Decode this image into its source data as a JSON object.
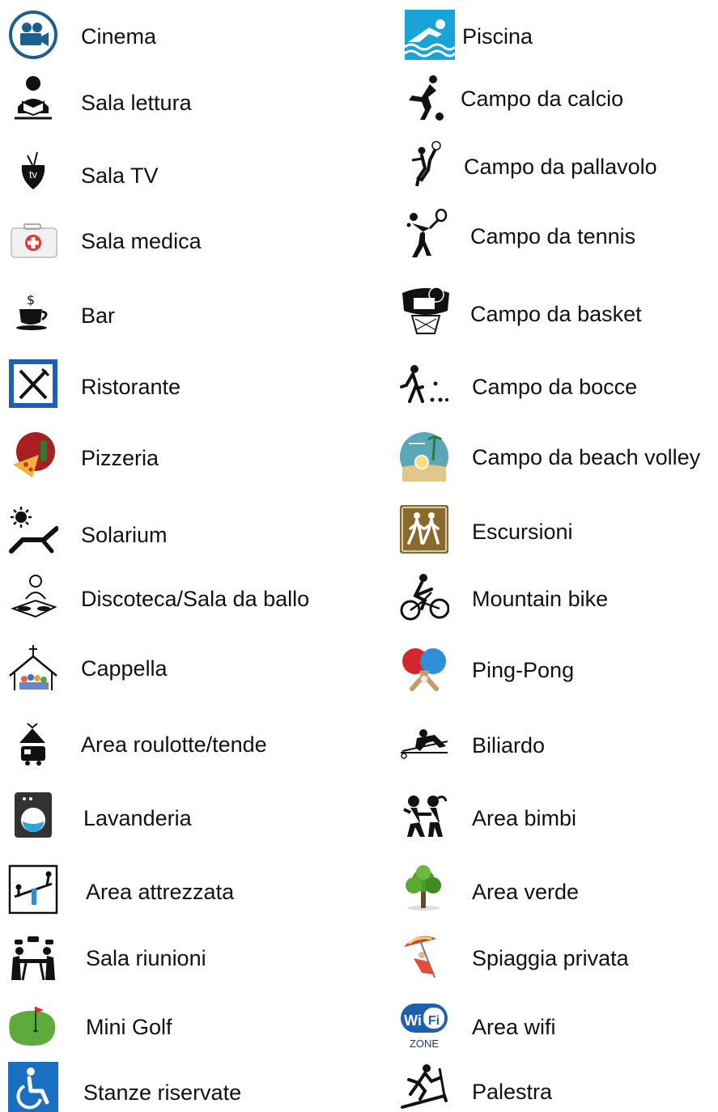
{
  "left": [
    {
      "label": "Cinema",
      "icon": "cinema-icon"
    },
    {
      "label": "Sala lettura",
      "icon": "reading-room-icon"
    },
    {
      "label": "Sala TV",
      "icon": "tv-icon"
    },
    {
      "label": "Sala medica",
      "icon": "first-aid-icon"
    },
    {
      "label": "Bar",
      "icon": "coffee-cup-icon"
    },
    {
      "label": "Ristorante",
      "icon": "restaurant-icon"
    },
    {
      "label": "Pizzeria",
      "icon": "pizza-icon"
    },
    {
      "label": "Solarium",
      "icon": "sunbed-icon"
    },
    {
      "label": "Discoteca/Sala da ballo",
      "icon": "dj-icon"
    },
    {
      "label": "Cappella",
      "icon": "chapel-icon"
    },
    {
      "label": "Area roulotte/tende",
      "icon": "caravan-tent-icon"
    },
    {
      "label": "Lavanderia",
      "icon": "washing-machine-icon"
    },
    {
      "label": "Area attrezzata",
      "icon": "playground-seesaw-icon"
    },
    {
      "label": "Sala riunioni",
      "icon": "meeting-room-icon"
    },
    {
      "label": "Mini Golf",
      "icon": "mini-golf-icon"
    },
    {
      "label": "Stanze riservate",
      "icon": "wheelchair-icon"
    }
  ],
  "right": [
    {
      "label": "Piscina",
      "icon": "swimmer-icon"
    },
    {
      "label": "Campo da calcio",
      "icon": "soccer-player-icon"
    },
    {
      "label": "Campo da pallavolo",
      "icon": "volleyball-player-icon"
    },
    {
      "label": "Campo da tennis",
      "icon": "tennis-player-icon"
    },
    {
      "label": "Campo da basket",
      "icon": "basketball-hoop-icon"
    },
    {
      "label": "Campo da bocce",
      "icon": "bocce-player-icon"
    },
    {
      "label": "Campo da beach volley",
      "icon": "beach-volley-icon"
    },
    {
      "label": "Escursioni",
      "icon": "hikers-icon"
    },
    {
      "label": "Mountain bike",
      "icon": "mountain-biker-icon"
    },
    {
      "label": "Ping-Pong",
      "icon": "ping-pong-paddles-icon"
    },
    {
      "label": "Biliardo",
      "icon": "billiards-player-icon"
    },
    {
      "label": "Area bimbi",
      "icon": "children-playing-icon"
    },
    {
      "label": "Area verde",
      "icon": "tree-icon"
    },
    {
      "label": "Spiaggia privata",
      "icon": "beach-umbrella-icon"
    },
    {
      "label": "Area wifi",
      "icon": "wifi-zone-icon",
      "text": [
        "Wi",
        "Fi",
        "ZONE"
      ]
    },
    {
      "label": "Palestra",
      "icon": "treadmill-runner-icon"
    }
  ],
  "colors": {
    "text": "#111111",
    "cinema_blue": "#1c5f8e",
    "sign_blue": "#1f5fb0",
    "wheelchair_blue": "#1b6fc0",
    "pool_blue": "#1aa3d6",
    "hiking_brown": "#8a6a2c",
    "pizza_red": "#a81f1f",
    "grass_green": "#5eaa3a",
    "ping_red": "#d4272b",
    "ping_blue": "#2e8fd6",
    "beach_teal": "#5aa7b8"
  }
}
